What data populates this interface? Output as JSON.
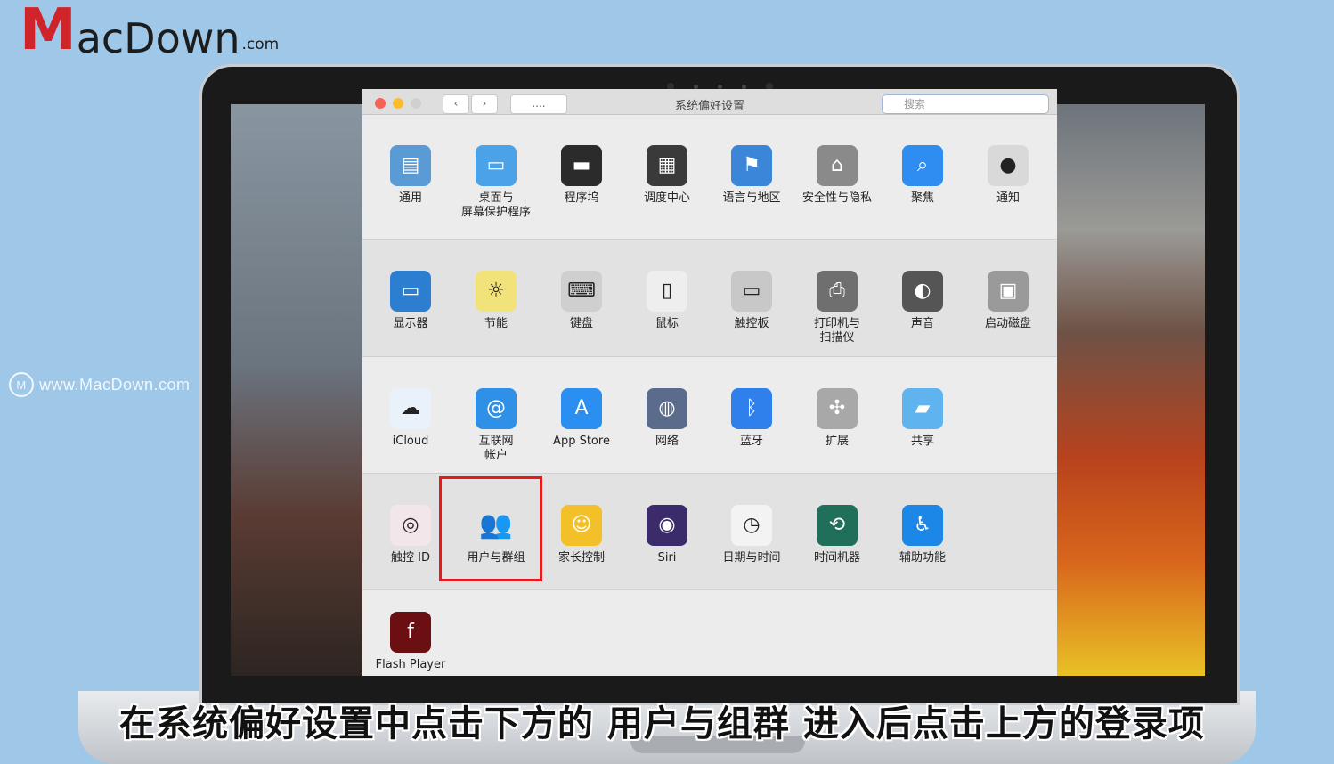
{
  "brand": {
    "logo_mark": "M",
    "logo_rest": "acDown",
    "logo_suffix": ".com",
    "watermark": "www.MacDown.com"
  },
  "window": {
    "title": "系统偏好设置",
    "nav_all": "....",
    "search_placeholder": "搜索"
  },
  "rows": [
    [
      {
        "name": "general",
        "label": "通用",
        "icon": "file-icon",
        "color": "#5b9bd5"
      },
      {
        "name": "desktop-screensaver",
        "label": "桌面与\n屏幕保护程序",
        "icon": "desktop-icon",
        "color": "#4aa3e8"
      },
      {
        "name": "dock",
        "label": "程序坞",
        "icon": "dock-icon",
        "color": "#2b2b2b"
      },
      {
        "name": "mission-control",
        "label": "调度中心",
        "icon": "mission-control-icon",
        "color": "#3a3a3a"
      },
      {
        "name": "language-region",
        "label": "语言与地区",
        "icon": "flag-icon",
        "color": "#3b86d8"
      },
      {
        "name": "security-privacy",
        "label": "安全性与隐私",
        "icon": "house-lock-icon",
        "color": "#8a8a8a"
      },
      {
        "name": "spotlight",
        "label": "聚焦",
        "icon": "magnifier-icon",
        "color": "#2f8cf0"
      },
      {
        "name": "notifications",
        "label": "通知",
        "icon": "notification-icon",
        "color": "#d9d9d9"
      }
    ],
    [
      {
        "name": "displays",
        "label": "显示器",
        "icon": "monitor-icon",
        "color": "#2c7fd0"
      },
      {
        "name": "energy-saver",
        "label": "节能",
        "icon": "bulb-icon",
        "color": "#f2e27a"
      },
      {
        "name": "keyboard",
        "label": "键盘",
        "icon": "keyboard-icon",
        "color": "#cfcfcf"
      },
      {
        "name": "mouse",
        "label": "鼠标",
        "icon": "mouse-icon",
        "color": "#eeeeee"
      },
      {
        "name": "trackpad",
        "label": "触控板",
        "icon": "trackpad-icon",
        "color": "#c8c8c8"
      },
      {
        "name": "printers-scanners",
        "label": "打印机与\n扫描仪",
        "icon": "printer-icon",
        "color": "#6f6f6f"
      },
      {
        "name": "sound",
        "label": "声音",
        "icon": "speaker-icon",
        "color": "#555555"
      },
      {
        "name": "startup-disk",
        "label": "启动磁盘",
        "icon": "disk-icon",
        "color": "#9a9a9a"
      }
    ],
    [
      {
        "name": "icloud",
        "label": "iCloud",
        "icon": "cloud-icon",
        "color": "#e9f2fb"
      },
      {
        "name": "internet-accounts",
        "label": "互联网\n帐户",
        "icon": "at-icon",
        "color": "#2f90e8"
      },
      {
        "name": "app-store",
        "label": "App Store",
        "icon": "app-store-icon",
        "color": "#2a8ff0"
      },
      {
        "name": "network",
        "label": "网络",
        "icon": "globe-icon",
        "color": "#5a6b8c"
      },
      {
        "name": "bluetooth",
        "label": "蓝牙",
        "icon": "bluetooth-icon",
        "color": "#2f80ed"
      },
      {
        "name": "extensions",
        "label": "扩展",
        "icon": "puzzle-icon",
        "color": "#a8a8a8"
      },
      {
        "name": "sharing",
        "label": "共享",
        "icon": "folder-icon",
        "color": "#5fb4ef"
      }
    ],
    [
      {
        "name": "touch-id",
        "label": "触控 ID",
        "icon": "fingerprint-icon",
        "color": "#f3e6ea"
      },
      {
        "name": "users-groups",
        "label": "用户与群组",
        "icon": "users-icon",
        "color": "#ececec"
      },
      {
        "name": "parental-controls",
        "label": "家长控制",
        "icon": "family-icon",
        "color": "#f4c02a"
      },
      {
        "name": "siri",
        "label": "Siri",
        "icon": "siri-icon",
        "color": "#3b2b6b"
      },
      {
        "name": "date-time",
        "label": "日期与时间",
        "icon": "clock-icon",
        "color": "#f3f3f3"
      },
      {
        "name": "time-machine",
        "label": "时间机器",
        "icon": "time-machine-icon",
        "color": "#1f6f5a"
      },
      {
        "name": "accessibility",
        "label": "辅助功能",
        "icon": "accessibility-icon",
        "color": "#1c87e6"
      }
    ],
    [
      {
        "name": "flash-player",
        "label": "Flash Player",
        "icon": "flash-icon",
        "color": "#6b0f12"
      }
    ]
  ],
  "subtitle": "在系统偏好设置中点击下方的 用户与组群 进入后点击上方的登录项"
}
